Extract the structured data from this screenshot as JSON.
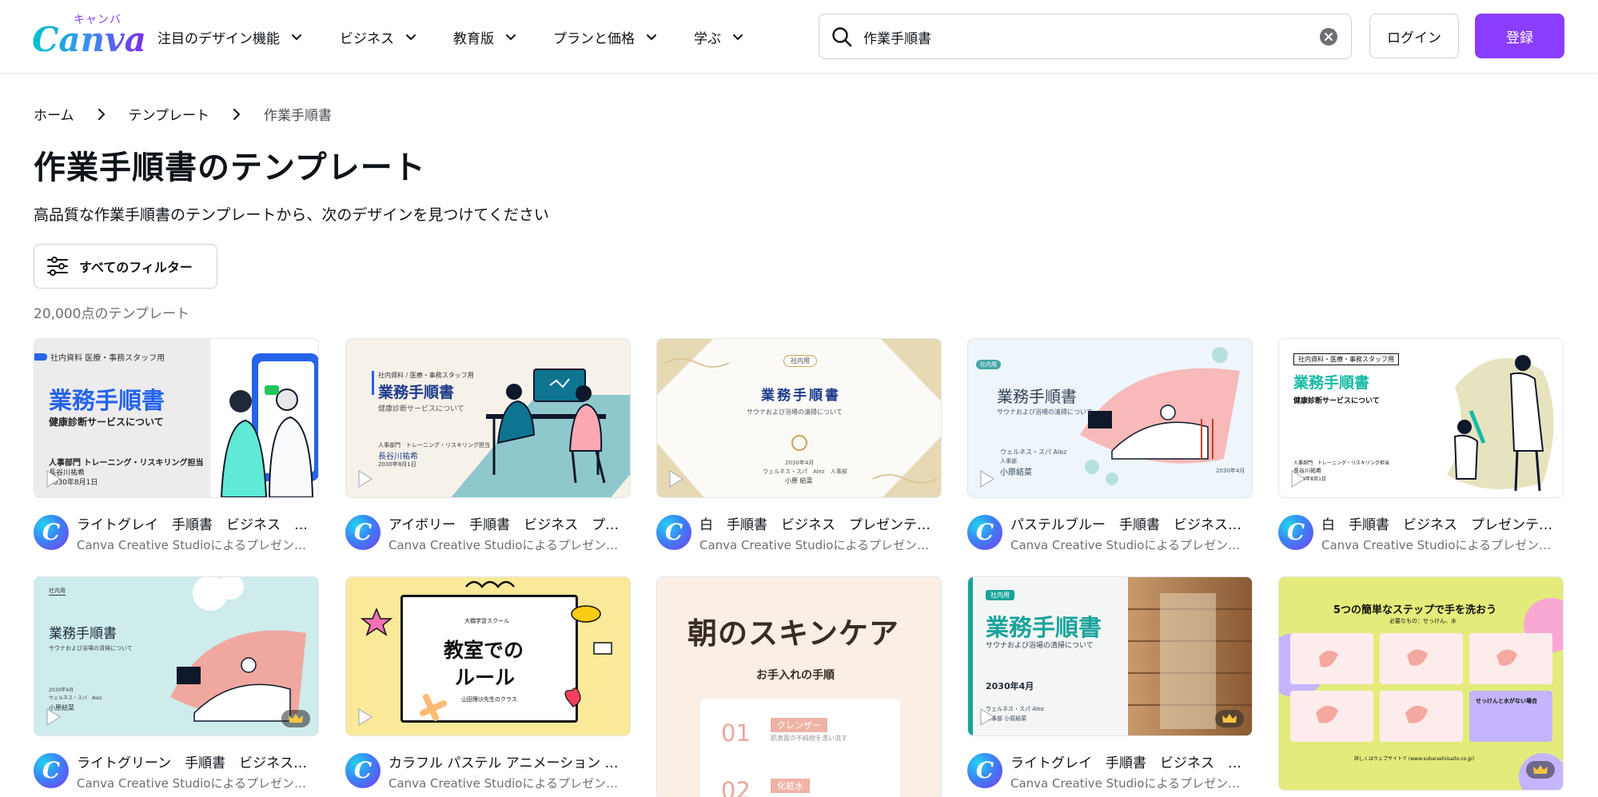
{
  "header": {
    "logo_word": "Canva",
    "logo_kana": "キャンバ",
    "nav": [
      {
        "label": "注目のデザイン機能"
      },
      {
        "label": "ビジネス"
      },
      {
        "label": "教育版"
      },
      {
        "label": "プランと価格"
      },
      {
        "label": "学ぶ"
      }
    ],
    "search_value": "作業手順書",
    "login_label": "ログイン",
    "signup_label": "登録"
  },
  "breadcrumb": {
    "home": "ホーム",
    "templates": "テンプレート",
    "current": "作業手順書"
  },
  "page": {
    "title": "作業手順書のテンプレート",
    "subtitle": "高品質な作業手順書のテンプレートから、次のデザインを見つけてください",
    "filter_label": "すべてのフィルター",
    "count": "20,000点のテンプレート"
  },
  "colors": {
    "brand_purple": "#8b3dff",
    "canva_teal": "#00c4cc"
  },
  "cards": [
    {
      "title": "ライトグレイ　手順書　ビジネス　プレゼンテーション",
      "by": "Canva Creative Studioによるプレゼンテーション",
      "thumb": {
        "tag": "社内資料 医療・事務スタッフ用",
        "heading": "業務手順書",
        "sub": "健康診断サービスについて",
        "footer1": "人事部門 トレーニング・リスキリング担当",
        "footer2": "長谷川祐希",
        "footer3": "2030年8月1日"
      }
    },
    {
      "title": "アイボリー　手順書　ビジネス　プレゼンテーション",
      "by": "Canva Creative Studioによるプレゼンテーション",
      "thumb": {
        "tag": "社内資料 / 医療・事務スタッフ用",
        "heading": "業務手順書",
        "sub": "健康診断サービスについて",
        "footer1": "人事部門　トレーニング・リスキリング担当",
        "footer2": "長谷川祐希",
        "footer3": "2030年8月1日"
      }
    },
    {
      "title": "白　手順書　ビジネス　プレゼンテーション",
      "by": "Canva Creative Studioによるプレゼンテーション",
      "thumb": {
        "tag": "社内用",
        "heading": "業務手順書",
        "sub": "サウナおよび浴場の清掃について",
        "footer1": "2030年4月",
        "footer2": "ウェルネス・スパ　Alez　人事部",
        "footer3": "小原 結菜"
      }
    },
    {
      "title": "パステルブルー　手順書　ビジネス　プレゼンテーション",
      "by": "Canva Creative Studioによるプレゼンテーション",
      "thumb": {
        "tag": "社内用",
        "heading": "業務手順書",
        "sub": "サウナおよび浴場の清掃について",
        "footer1": "ウェルネス・スパ Alez",
        "footer2": "人事部",
        "footer3": "小原結菜",
        "date": "2030年4月"
      }
    },
    {
      "title": "白　手順書　ビジネス　プレゼンテーション",
      "by": "Canva Creative Studioによるプレゼンテーション",
      "thumb": {
        "tag": "社内資料・医療・事務スタッフ用",
        "heading": "業務手順書",
        "sub": "健康診断サービスについて",
        "footer1": "人事部門　トレーニング・リスキリング担当",
        "footer2": "長谷川祐希",
        "footer3": "2030年8月1日"
      }
    },
    {
      "title": "ライトグリーン　手順書　ビジネス　プレゼンテーション",
      "by": "Canva Creative Studioによるプレゼンテーション",
      "thumb": {
        "tag": "社内用",
        "heading": "業務手順書",
        "sub": "サウナおよび浴場の清掃について",
        "footer1": "2030年4月",
        "footer2": "ウェルネス・スパ　Alez",
        "footer3": "小原結菜"
      }
    },
    {
      "title": "カラフル パステル アニメーション 手順書 プレゼンテーション",
      "by": "Canva Creative Studioによるプレゼンテーション",
      "thumb": {
        "tag": "大橋学習スクール",
        "heading1": "教室での",
        "heading2": "ルール",
        "sub": "山田理沙先生のクラス"
      }
    },
    {
      "title": "",
      "by": "",
      "thumb": {
        "heading": "朝のスキンケア",
        "sub": "お手入れの手順",
        "step1_num": "01",
        "step1_label": "クレンザー",
        "step1_text": "肌表面の不純物を洗い流す",
        "step2_num": "02",
        "step2_label": "化粧水"
      }
    },
    {
      "title": "ライトグレイ　手順書　ビジネス　プレゼンテーション",
      "by": "Canva Creative Studioによるプレゼンテーション",
      "thumb": {
        "tag": "社内用",
        "heading": "業務手順書",
        "sub": "サウナおよび浴場の清掃について",
        "date": "2030年4月",
        "footer1": "ウェルネス・スパ Alez",
        "footer2": "人事部 小原結菜"
      }
    },
    {
      "title": "",
      "by": "",
      "thumb": {
        "heading": "5つの簡単なステップで手を洗おう",
        "sub": "必要なもの：せっけん、水",
        "box_title": "せっけんと水がない場合",
        "footer": "詳しくはウェブサイトで (www.subarashiisaito.co.jp)"
      }
    }
  ]
}
